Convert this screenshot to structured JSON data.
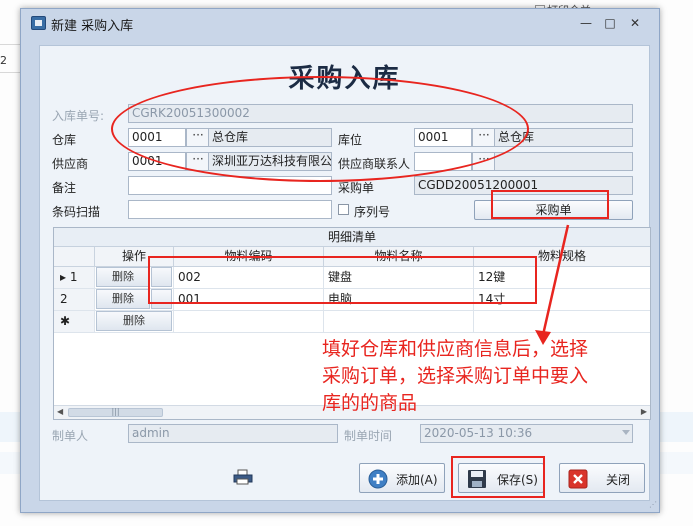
{
  "background": {
    "checkbox_label": "打印合并",
    "left_stub": "2"
  },
  "window": {
    "title": "新建 采购入库",
    "min_glyph": "—",
    "max_glyph": "□",
    "close_glyph": "✕"
  },
  "form": {
    "heading": "采购入库",
    "receipt_no": {
      "label": "入库单号:",
      "value": "CGRK20051300002"
    },
    "warehouse": {
      "label": "仓库",
      "code": "0001",
      "name": "总仓库"
    },
    "location": {
      "label": "库位",
      "code": "0001",
      "name": "总仓库"
    },
    "supplier": {
      "label": "供应商",
      "code": "0001",
      "name": "深圳亚万达科技有限公"
    },
    "supplier_contact": {
      "label": "供应商联系人",
      "value": ""
    },
    "remark": {
      "label": "备注",
      "value": ""
    },
    "purchase_order": {
      "label": "采购单",
      "value": "CGDD20051200001"
    },
    "barcode": {
      "label": "条码扫描",
      "value": ""
    },
    "serial_checkbox": {
      "label": "序列号",
      "checked": false
    },
    "purchase_order_button": "采购单",
    "ellipsis": "···"
  },
  "grid": {
    "caption": "明细清单",
    "columns": [
      "操作",
      "物料编码",
      "物料名称",
      "物料规格"
    ],
    "delete_label": "删除",
    "rows": [
      {
        "indicator": "▸ 1",
        "code": "002",
        "name": "键盘",
        "spec": "12键"
      },
      {
        "indicator": "2",
        "code": "001",
        "name": "电脑",
        "spec": "14寸"
      },
      {
        "indicator": "✱",
        "code": "",
        "name": "",
        "spec": ""
      }
    ],
    "scroll_left": "◀",
    "scroll_right": "▶",
    "scroll_thumb": "|||"
  },
  "footer": {
    "creator_label": "制单人",
    "creator_value": "admin",
    "created_time_label": "制单时间",
    "created_time_value": "2020-05-13 10:36"
  },
  "buttons": {
    "add": "添加(A)",
    "save": "保存(S)",
    "close": "关闭"
  },
  "annotation": {
    "text": "填好仓库和供应商信息后，选择\n采购订单，选择采购订单中要入\n库的的商品",
    "color": "#e8251f"
  }
}
